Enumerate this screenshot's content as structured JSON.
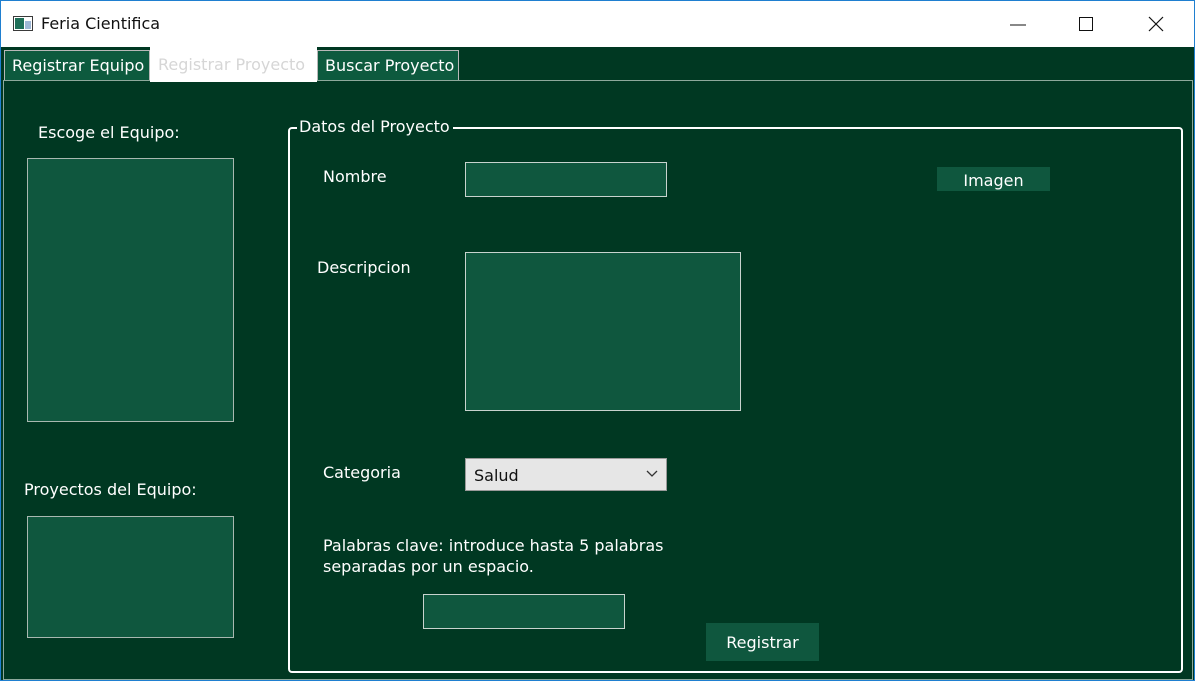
{
  "window": {
    "title": "Feria Cientifica"
  },
  "tabs": [
    {
      "label": "Registrar Equipo",
      "active": false
    },
    {
      "label": "Registrar Proyecto",
      "active": true
    },
    {
      "label": "Buscar Proyecto",
      "active": false
    }
  ],
  "left_panel": {
    "team_label": "Escoge el Equipo:",
    "projects_label": "Proyectos del Equipo:"
  },
  "project_group": {
    "title": "Datos del Proyecto",
    "name_label": "Nombre",
    "name_value": "",
    "image_button": "Imagen",
    "description_label": "Descripcion",
    "description_value": "",
    "category_label": "Categoria",
    "category_selected": "Salud",
    "keywords_label_line1": "Palabras clave: introduce hasta 5 palabras",
    "keywords_label_line2": "separadas por un espacio.",
    "keywords_value": "",
    "register_button": "Registrar"
  },
  "icons": {
    "app": "window-app-icon",
    "minimize": "minimize-icon",
    "maximize": "maximize-icon",
    "close": "close-icon",
    "dropdown": "chevron-down-icon"
  },
  "colors": {
    "background": "#003822",
    "control": "#0f573e",
    "text": "#ffffff"
  }
}
